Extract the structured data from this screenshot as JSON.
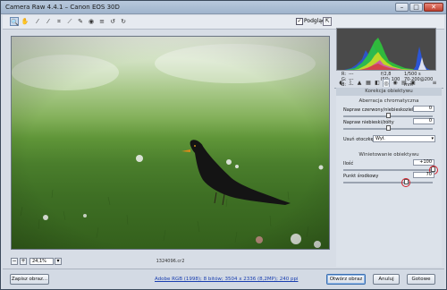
{
  "window": {
    "title": "Camera Raw 4.4.1 – Canon EOS 30D",
    "min_label": "–",
    "max_label": "□",
    "close_label": "✕"
  },
  "toolbar": {
    "tools": [
      {
        "name": "zoom-tool",
        "glyph": "🔍"
      },
      {
        "name": "hand-tool",
        "glyph": "✋"
      },
      {
        "name": "white-balance-tool",
        "glyph": "⁄"
      },
      {
        "name": "color-sampler-tool",
        "glyph": "⁄"
      },
      {
        "name": "crop-tool",
        "glyph": "⌗"
      },
      {
        "name": "straighten-tool",
        "glyph": "⟋"
      },
      {
        "name": "retouch-tool",
        "glyph": "✎"
      },
      {
        "name": "red-eye-tool",
        "glyph": "◉"
      },
      {
        "name": "preferences-tool",
        "glyph": "≡"
      },
      {
        "name": "rotate-left-tool",
        "glyph": "↺"
      },
      {
        "name": "rotate-right-tool",
        "glyph": "↻"
      }
    ],
    "preview_label": "Podgląd",
    "preview_checked": "✓",
    "fullscreen_glyph": "⇱"
  },
  "preview": {
    "zoom_value": "24,1%",
    "zoom_out": "−",
    "zoom_in": "+",
    "filename": "1324096.cr2"
  },
  "histogram": {
    "readout": {
      "r_label": "R:",
      "g_label": "G:",
      "b_label": "B:",
      "r_value": "---",
      "g_value": "---",
      "b_value": "---",
      "aperture": "f/2,8",
      "shutter": "1/500 s",
      "iso": "ISO: 100",
      "lens": "70-200@200 mm"
    }
  },
  "panel": {
    "title": "Korekcja obiektywu",
    "chromatic": {
      "title": "Aberracja chromatyczna",
      "red_cyan_label": "Napraw czerwony/niebieskozielony",
      "red_cyan_value": "0",
      "blue_yellow_label": "Napraw niebieski/żółty",
      "blue_yellow_value": "0",
      "defringe_label": "Usuń otoczkę:",
      "defringe_value": "Wył.",
      "red_cyan_level": 0.5,
      "blue_yellow_level": 0.5
    },
    "vignetting": {
      "title": "Winietowanie obiektywu",
      "amount_label": "Ilość",
      "amount_value": "+100",
      "amount_level": 1.0,
      "midpoint_label": "Punkt środkowy",
      "midpoint_value": "70",
      "midpoint_level": 0.7
    }
  },
  "footer": {
    "save_label": "Zapisz obraz...",
    "workflow_link": "Adobe RGB (1998); 8 bitów; 3504 x 2336 (8,2MP); 240 ppi",
    "open_label": "Otwórz obraz",
    "cancel_label": "Anuluj",
    "done_label": "Gotowe"
  },
  "colors": {
    "accent": "#3b6fb0",
    "highlight_ring": "#d4202a"
  }
}
